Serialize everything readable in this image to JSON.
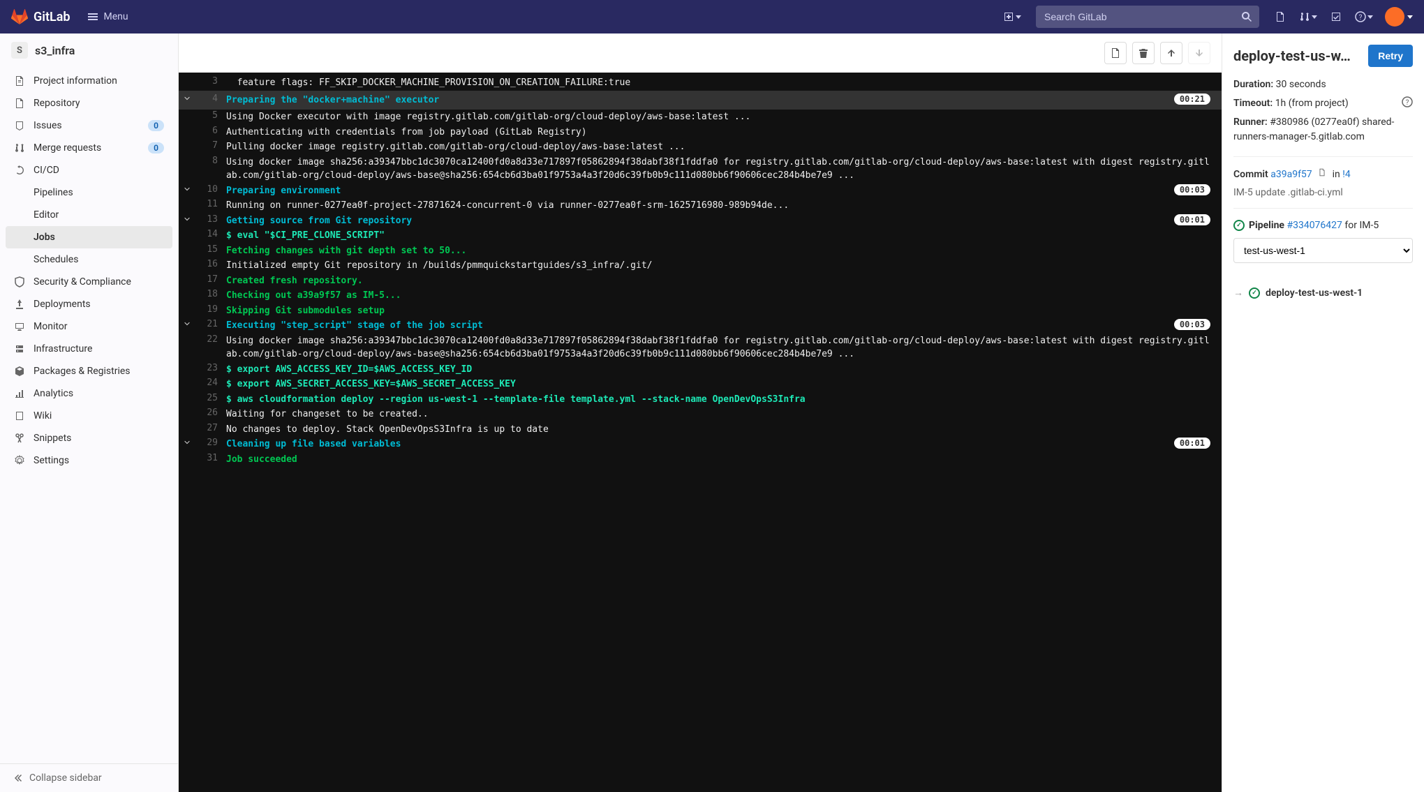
{
  "brand": "GitLab",
  "menu_label": "Menu",
  "search_placeholder": "Search GitLab",
  "project": {
    "initial": "S",
    "name": "s3_infra"
  },
  "sidebar": {
    "items": [
      {
        "icon": "info",
        "label": "Project information"
      },
      {
        "icon": "repo",
        "label": "Repository"
      },
      {
        "icon": "issues",
        "label": "Issues",
        "badge": "0"
      },
      {
        "icon": "mr",
        "label": "Merge requests",
        "badge": "0"
      },
      {
        "icon": "cicd",
        "label": "CI/CD",
        "sub": [
          {
            "label": "Pipelines"
          },
          {
            "label": "Editor"
          },
          {
            "label": "Jobs",
            "active": true
          },
          {
            "label": "Schedules"
          }
        ]
      },
      {
        "icon": "shield",
        "label": "Security & Compliance"
      },
      {
        "icon": "deploy",
        "label": "Deployments"
      },
      {
        "icon": "monitor",
        "label": "Monitor"
      },
      {
        "icon": "infra",
        "label": "Infrastructure"
      },
      {
        "icon": "package",
        "label": "Packages & Registries"
      },
      {
        "icon": "analytics",
        "label": "Analytics"
      },
      {
        "icon": "wiki",
        "label": "Wiki"
      },
      {
        "icon": "snippets",
        "label": "Snippets"
      },
      {
        "icon": "settings",
        "label": "Settings"
      }
    ],
    "collapse": "Collapse sidebar"
  },
  "log_lines": [
    {
      "ln": 3,
      "cls": "c-white",
      "txt": "  feature flags: FF_SKIP_DOCKER_MACHINE_PROVISION_ON_CREATION_FAILURE:true"
    },
    {
      "ln": 4,
      "cls": "c-cyan",
      "txt": "Preparing the \"docker+machine\" executor",
      "arrow": true,
      "dur": "00:21",
      "hl": true
    },
    {
      "ln": 5,
      "cls": "c-white",
      "txt": "Using Docker executor with image registry.gitlab.com/gitlab-org/cloud-deploy/aws-base:latest ..."
    },
    {
      "ln": 6,
      "cls": "c-white",
      "txt": "Authenticating with credentials from job payload (GitLab Registry)"
    },
    {
      "ln": 7,
      "cls": "c-white",
      "txt": "Pulling docker image registry.gitlab.com/gitlab-org/cloud-deploy/aws-base:latest ..."
    },
    {
      "ln": 8,
      "cls": "c-white",
      "txt": "Using docker image sha256:a39347bbc1dc3070ca12400fd0a8d33e717897f05862894f38dabf38f1fddfa0 for registry.gitlab.com/gitlab-org/cloud-deploy/aws-base:latest with digest registry.gitlab.com/gitlab-org/cloud-deploy/aws-base@sha256:654cb6d3ba01f9753a4a3f20d6c39fb0b9c111d080bb6f90606cec284b4be7e9 ..."
    },
    {
      "ln": 10,
      "cls": "c-cyan",
      "txt": "Preparing environment",
      "arrow": true,
      "dur": "00:03"
    },
    {
      "ln": 11,
      "cls": "c-white",
      "txt": "Running on runner-0277ea0f-project-27871624-concurrent-0 via runner-0277ea0f-srm-1625716980-989b94de..."
    },
    {
      "ln": 13,
      "cls": "c-cyan",
      "txt": "Getting source from Git repository",
      "arrow": true,
      "dur": "00:01"
    },
    {
      "ln": 14,
      "cls": "c-green-b",
      "txt": "$ eval \"$CI_PRE_CLONE_SCRIPT\""
    },
    {
      "ln": 15,
      "cls": "c-green",
      "txt": "Fetching changes with git depth set to 50..."
    },
    {
      "ln": 16,
      "cls": "c-white",
      "txt": "Initialized empty Git repository in /builds/pmmquickstartguides/s3_infra/.git/"
    },
    {
      "ln": 17,
      "cls": "c-green",
      "txt": "Created fresh repository."
    },
    {
      "ln": 18,
      "cls": "c-green",
      "txt": "Checking out a39a9f57 as IM-5..."
    },
    {
      "ln": 19,
      "cls": "c-green",
      "txt": "Skipping Git submodules setup"
    },
    {
      "ln": 21,
      "cls": "c-cyan",
      "txt": "Executing \"step_script\" stage of the job script",
      "arrow": true,
      "dur": "00:03"
    },
    {
      "ln": 22,
      "cls": "c-white",
      "txt": "Using docker image sha256:a39347bbc1dc3070ca12400fd0a8d33e717897f05862894f38dabf38f1fddfa0 for registry.gitlab.com/gitlab-org/cloud-deploy/aws-base:latest with digest registry.gitlab.com/gitlab-org/cloud-deploy/aws-base@sha256:654cb6d3ba01f9753a4a3f20d6c39fb0b9c111d080bb6f90606cec284b4be7e9 ..."
    },
    {
      "ln": 23,
      "cls": "c-green-b",
      "txt": "$ export AWS_ACCESS_KEY_ID=$AWS_ACCESS_KEY_ID"
    },
    {
      "ln": 24,
      "cls": "c-green-b",
      "txt": "$ export AWS_SECRET_ACCESS_KEY=$AWS_SECRET_ACCESS_KEY"
    },
    {
      "ln": 25,
      "cls": "c-green-b",
      "txt": "$ aws cloudformation deploy --region us-west-1 --template-file template.yml --stack-name OpenDevOpsS3Infra"
    },
    {
      "ln": 26,
      "cls": "c-white",
      "txt": "Waiting for changeset to be created.."
    },
    {
      "ln": 27,
      "cls": "c-white",
      "txt": "No changes to deploy. Stack OpenDevOpsS3Infra is up to date"
    },
    {
      "ln": 29,
      "cls": "c-cyan",
      "txt": "Cleaning up file based variables",
      "arrow": true,
      "dur": "00:01"
    },
    {
      "ln": 31,
      "cls": "c-green",
      "txt": "Job succeeded"
    }
  ],
  "rpanel": {
    "title": "deploy-test-us-w…",
    "retry": "Retry",
    "duration_label": "Duration:",
    "duration_val": "30 seconds",
    "timeout_label": "Timeout:",
    "timeout_val": "1h (from project)",
    "runner_label": "Runner:",
    "runner_val": "#380986 (0277ea0f) shared-runners-manager-5.gitlab.com",
    "commit_label": "Commit",
    "commit_sha": "a39a9f57",
    "commit_in": "in",
    "commit_mr": "!4",
    "commit_msg": "IM-5 update .gitlab-ci.yml",
    "pipeline_label": "Pipeline",
    "pipeline_id": "#334076427",
    "pipeline_for": "for",
    "pipeline_branch": "IM-5",
    "stage_selected": "test-us-west-1",
    "job_name": "deploy-test-us-west-1"
  }
}
